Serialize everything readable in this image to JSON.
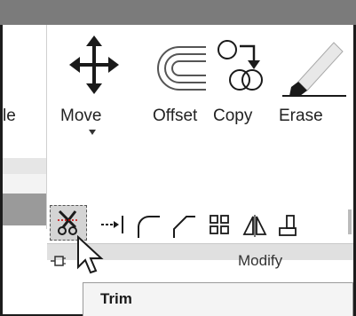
{
  "ribbon": {
    "left_cut_label": "le",
    "buttons": [
      {
        "label": "Move",
        "icon": "move-arrows-icon"
      },
      {
        "label": "Offset",
        "icon": "offset-icon"
      },
      {
        "label": "Copy",
        "icon": "copy-icon"
      },
      {
        "label": "Erase",
        "icon": "eraser-icon"
      }
    ],
    "small_tools": [
      {
        "icon": "trim-scissors-icon",
        "selected": true
      },
      {
        "icon": "extend-icon"
      },
      {
        "icon": "fillet-icon"
      },
      {
        "icon": "chamfer-icon"
      },
      {
        "icon": "array-icon"
      },
      {
        "icon": "mirror-icon"
      },
      {
        "icon": "stretch-icon"
      }
    ],
    "panel_title": "Modify"
  },
  "tooltip": {
    "title": "Trim"
  },
  "colors": {
    "titlebar": "#7b7b7b",
    "icon_stroke": "#1a1a1a",
    "highlight": "#d4d4d4",
    "footer": "#e0e0e0"
  }
}
